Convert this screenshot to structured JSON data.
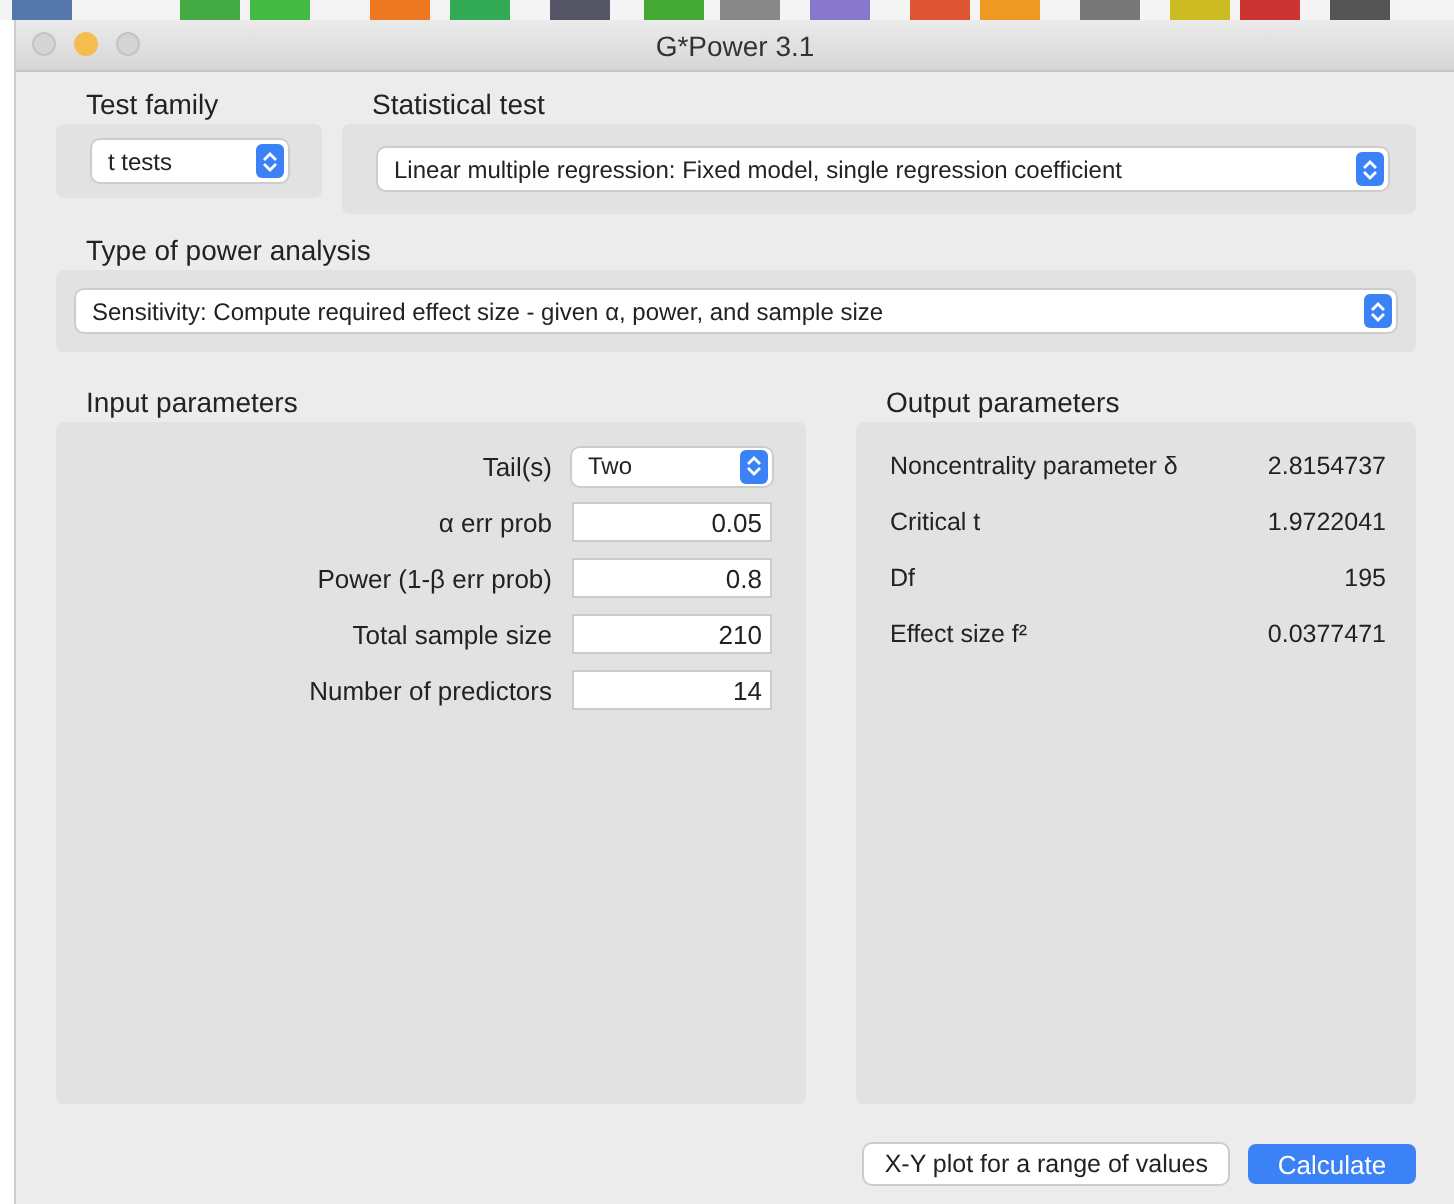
{
  "window": {
    "title": "G*Power 3.1"
  },
  "test_family": {
    "label": "Test family",
    "value": "t tests"
  },
  "statistical_test": {
    "label": "Statistical test",
    "value": "Linear multiple regression: Fixed model, single regression coefficient"
  },
  "power_analysis": {
    "label": "Type of power analysis",
    "value": "Sensitivity: Compute required effect size - given α, power, and sample size"
  },
  "input_parameters": {
    "label": "Input parameters",
    "rows": [
      {
        "label": "Tail(s)",
        "kind": "select",
        "value": "Two"
      },
      {
        "label": "α err prob",
        "kind": "input",
        "value": "0.05"
      },
      {
        "label": "Power (1-β err prob)",
        "kind": "input",
        "value": "0.8"
      },
      {
        "label": "Total sample size",
        "kind": "input",
        "value": "210"
      },
      {
        "label": "Number of predictors",
        "kind": "input",
        "value": "14"
      }
    ]
  },
  "output_parameters": {
    "label": "Output parameters",
    "rows": [
      {
        "label": "Noncentrality parameter δ",
        "value": "2.8154737"
      },
      {
        "label": "Critical t",
        "value": "1.9722041"
      },
      {
        "label": "Df",
        "value": "195"
      },
      {
        "label": "Effect size f²",
        "value": "0.0377471"
      }
    ]
  },
  "buttons": [
    {
      "label": "X-Y plot for a range of values",
      "kind": "secondary"
    },
    {
      "label": "Calculate",
      "kind": "primary"
    }
  ]
}
